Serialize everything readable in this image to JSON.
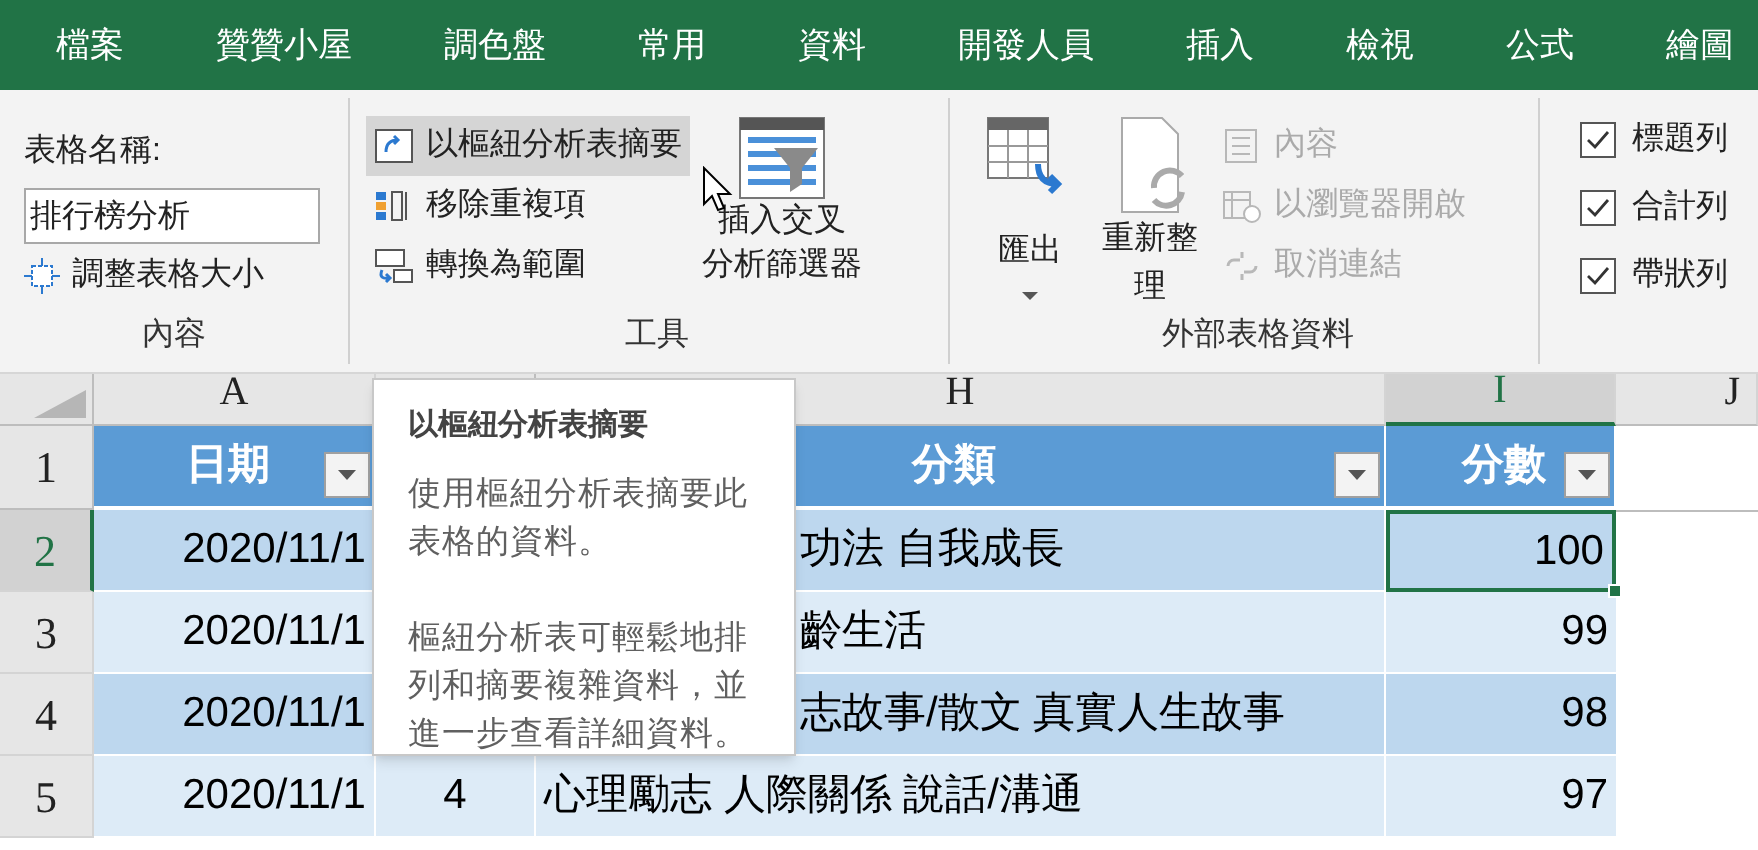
{
  "tabs": [
    {
      "label": "檔案"
    },
    {
      "label": "贊贊小屋"
    },
    {
      "label": "調色盤"
    },
    {
      "label": "常用"
    },
    {
      "label": "資料"
    },
    {
      "label": "開發人員"
    },
    {
      "label": "插入"
    },
    {
      "label": "檢視"
    },
    {
      "label": "公式"
    },
    {
      "label": "繪圖"
    }
  ],
  "properties_group": {
    "name_label": "表格名稱:",
    "name_value": "排行榜分析",
    "resize_button": "調整表格大小",
    "group_label": "內容"
  },
  "tools_group": {
    "buttons": [
      {
        "kind": "pivot",
        "label": "以樞紐分析表摘要",
        "hovered": true
      },
      {
        "kind": "dedupe",
        "label": "移除重複項",
        "hovered": false
      },
      {
        "kind": "range",
        "label": "轉換為範圍",
        "hovered": false
      }
    ],
    "slicer_button": [
      "插入交叉",
      "分析篩選器"
    ],
    "group_label": "工具"
  },
  "external_group": {
    "export_button": "匯出",
    "refresh_button": [
      "重新整",
      "理"
    ],
    "small_buttons": [
      {
        "kind": "properties",
        "label": "內容",
        "disabled": true
      },
      {
        "kind": "browser",
        "label": "以瀏覽器開啟",
        "disabled": true
      },
      {
        "kind": "unlink",
        "label": "取消連結",
        "disabled": true
      }
    ],
    "group_label": "外部表格資料"
  },
  "style_options": [
    {
      "label": "標題列",
      "checked": true
    },
    {
      "label": "合計列",
      "checked": true
    },
    {
      "label": "帶狀列",
      "checked": true
    }
  ],
  "grid": {
    "columns": [
      {
        "letter": "A",
        "selected": false
      },
      {
        "letter": "H",
        "selected": false
      },
      {
        "letter": "I",
        "selected": true
      },
      {
        "letter": "J",
        "selected": false
      }
    ],
    "header_row": {
      "number": "1",
      "selected": false,
      "cells": [
        {
          "text": "日期",
          "filter": true
        },
        {
          "text": "分類",
          "filter": true
        },
        {
          "text": "分數",
          "filter": true
        }
      ]
    },
    "rows": [
      {
        "number": "2",
        "selected": true,
        "date": "2020/11/1",
        "category": "功法 自我成長",
        "covered": true,
        "score": "100"
      },
      {
        "number": "3",
        "selected": false,
        "date": "2020/11/1",
        "category": "齡生活",
        "covered": true,
        "score": "99"
      },
      {
        "number": "4",
        "selected": false,
        "date": "2020/11/1",
        "category": "志故事/散文 真實人生故事",
        "covered": true,
        "score": "98"
      },
      {
        "number": "5",
        "selected": false,
        "date": "2020/11/1",
        "rank": "4",
        "category": "心理勵志 人際關係 說話/溝通",
        "covered": false,
        "score": "97"
      }
    ]
  },
  "tooltip": {
    "title": "以樞紐分析表摘要",
    "paragraphs": [
      "使用樞紐分析表摘要此表格的資料。",
      "樞紐分析表可輕鬆地排列和摘要複雜資料，並進一步查看詳細資料。"
    ]
  }
}
